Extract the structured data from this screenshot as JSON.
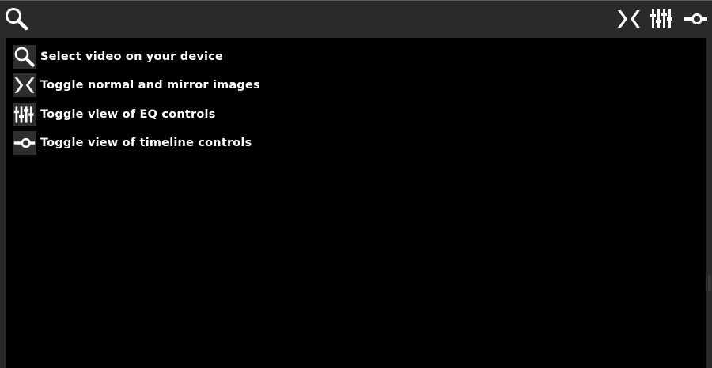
{
  "toolbar": {
    "buttons": [
      {
        "icon": "search-icon",
        "label": "Select video on your device"
      },
      {
        "icon": "mirror-icon",
        "label": "Toggle normal and mirror images"
      },
      {
        "icon": "eq-icon",
        "label": "Toggle view of EQ controls"
      },
      {
        "icon": "timeline-icon",
        "label": "Toggle view of timeline controls"
      }
    ]
  },
  "help": {
    "items": [
      {
        "icon": "search-icon",
        "text": "Select video on your device"
      },
      {
        "icon": "mirror-icon",
        "text": "Toggle normal and mirror images"
      },
      {
        "icon": "eq-icon",
        "text": "Toggle view of EQ controls"
      },
      {
        "icon": "timeline-icon",
        "text": "Toggle view of timeline controls"
      }
    ]
  },
  "colors": {
    "toolbar_bg": "#2a2a2a",
    "content_bg": "#000000",
    "icon_tile_bg": "#2e2e2e",
    "foreground": "#ffffff"
  }
}
